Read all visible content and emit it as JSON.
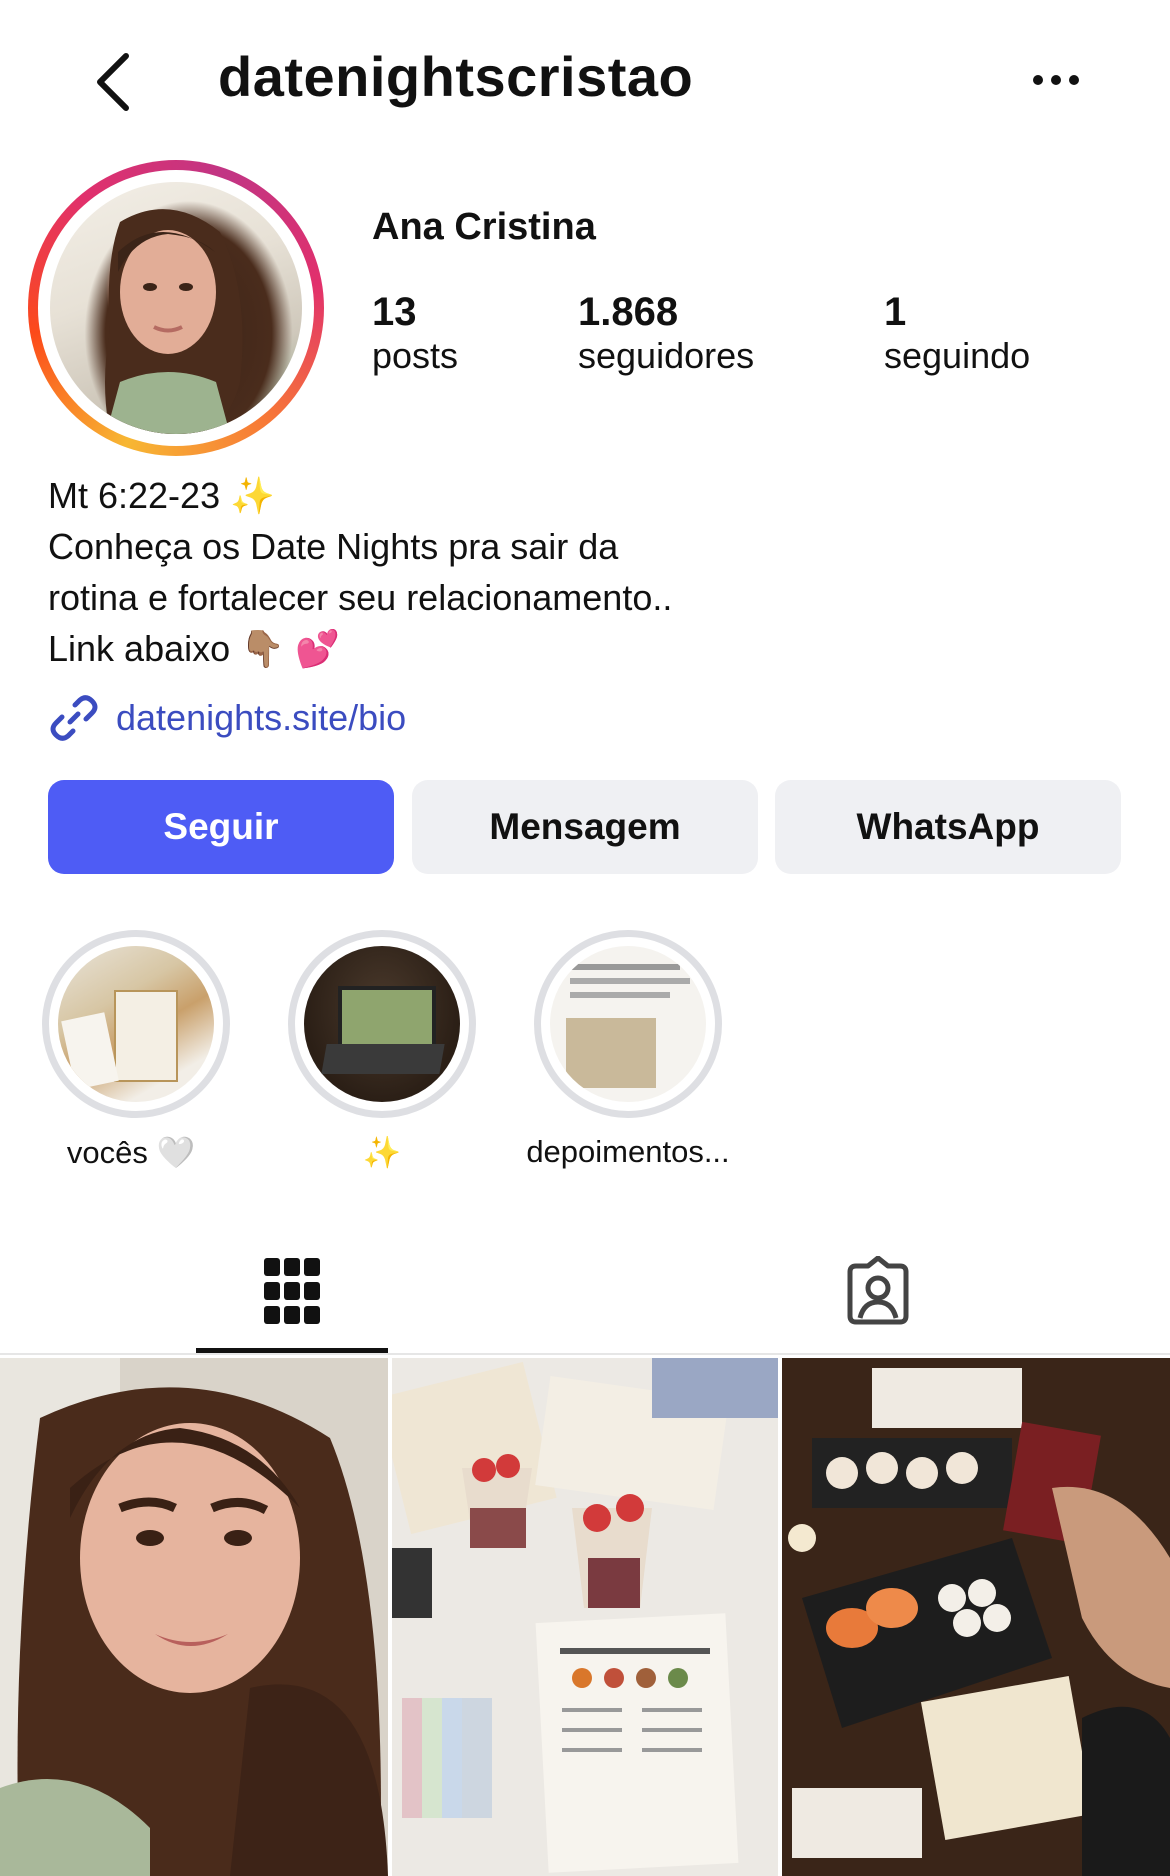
{
  "header": {
    "username": "datenightscristao",
    "back_icon": "chevron-left-icon",
    "more_icon": "ellipsis-icon"
  },
  "profile": {
    "display_name": "Ana Cristina",
    "stats": [
      {
        "value": "13",
        "label": "posts"
      },
      {
        "value": "1.868",
        "label": "seguidores"
      },
      {
        "value": "1",
        "label": "seguindo"
      }
    ],
    "bio_lines": [
      "Mt 6:22-23 ✨",
      "Conheça os Date Nights pra sair da",
      "rotina e fortalecer seu relacionamento..",
      "Link abaixo 👇🏽 💕"
    ],
    "link_text": "datenights.site/bio",
    "link_icon": "link-icon"
  },
  "actions": {
    "follow_label": "Seguir",
    "message_label": "Mensagem",
    "whatsapp_label": "WhatsApp",
    "follow_color": "#4e5cf5"
  },
  "highlights": [
    {
      "label": "vocês 🤍"
    },
    {
      "label": "✨"
    },
    {
      "label": "depoimentos..."
    }
  ],
  "tabs": [
    {
      "name": "posts-grid",
      "icon": "grid-icon",
      "active": true
    },
    {
      "name": "tagged",
      "icon": "tagged-person-icon",
      "active": false
    }
  ]
}
